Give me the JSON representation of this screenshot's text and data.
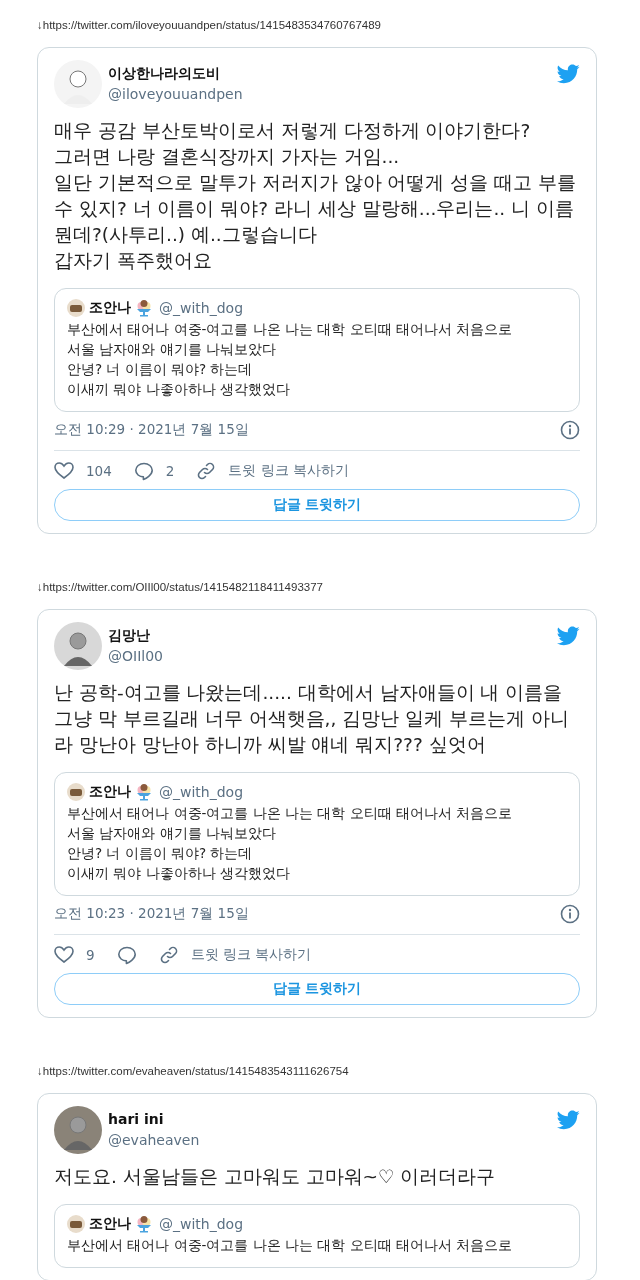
{
  "tweets": [
    {
      "url": "↓https://twitter.com/iloveyouuandpen/status/1415483534760767489",
      "author": {
        "name": "이상한나라의도비",
        "handle": "@iloveyouuandpen"
      },
      "paragraphs": [
        "매우 공감 부산토박이로서 저렇게 다정하게 이야기한다?",
        "그러면 나랑 결혼식장까지 가자는 거임...",
        "일단 기본적으로 말투가 저러지가 않아 어떻게 성을 때고 부를 수 있지? 너 이름이 뭐야? 라니 세상 말랑해...우리는.. 니 이름 뭔데?(사투리..) 예..그렇습니다",
        "갑자기 폭주했어요"
      ],
      "quote": {
        "name": "조안나",
        "handle": "@_with_dog",
        "lines": [
          "부산에서 태어나 여중-여고를 나온 나는 대학 오티때 태어나서 처음으로",
          "서울 남자애와 얘기를 나눠보았다",
          "안녕? 너 이름이 뭐야? 하는데",
          "이새끼 뭐야 나좋아하나 생각했었다"
        ]
      },
      "time": "오전 10:29 · 2021년 7월 15일",
      "likes": "104",
      "replies": "2",
      "copy_link": "트윗 링크 복사하기",
      "reply_button": "답글 트윗하기"
    },
    {
      "url": "↓https://twitter.com/OIIl00/status/1415482118411493377",
      "author": {
        "name": "김망난",
        "handle": "@OIIl00"
      },
      "paragraphs": [
        "난 공학-여고를 나왔는데..... 대학에서 남자애들이 내 이름을 그냥 막 부르길래 너무 어색햇음,, 김망난 일케 부르는게 아니라 망난아 망난아 하니까 씨발 얘네 뭐지??? 싶엇어"
      ],
      "quote": {
        "name": "조안나",
        "handle": "@_with_dog",
        "lines": [
          "부산에서 태어나 여중-여고를 나온 나는 대학 오티때 태어나서 처음으로",
          "서울 남자애와 얘기를 나눠보았다",
          "안녕? 너 이름이 뭐야? 하는데",
          "이새끼 뭐야 나좋아하나 생각했었다"
        ]
      },
      "time": "오전 10:23 · 2021년 7월 15일",
      "likes": "9",
      "copy_link": "트윗 링크 복사하기",
      "reply_button": "답글 트윗하기"
    },
    {
      "url": "↓https://twitter.com/evaheaven/status/1415483543111626754",
      "author": {
        "name": "hari ini",
        "handle": "@evaheaven"
      },
      "paragraphs": [
        "저도요. 서울남들은 고마워도 고마워~♡ 이러더라구"
      ],
      "quote": {
        "name": "조안나",
        "handle": "@_with_dog",
        "lines": [
          "부산에서 태어나 여중-여고를 나온 나는 대학 오티때 태어나서 처음으로"
        ]
      }
    }
  ]
}
